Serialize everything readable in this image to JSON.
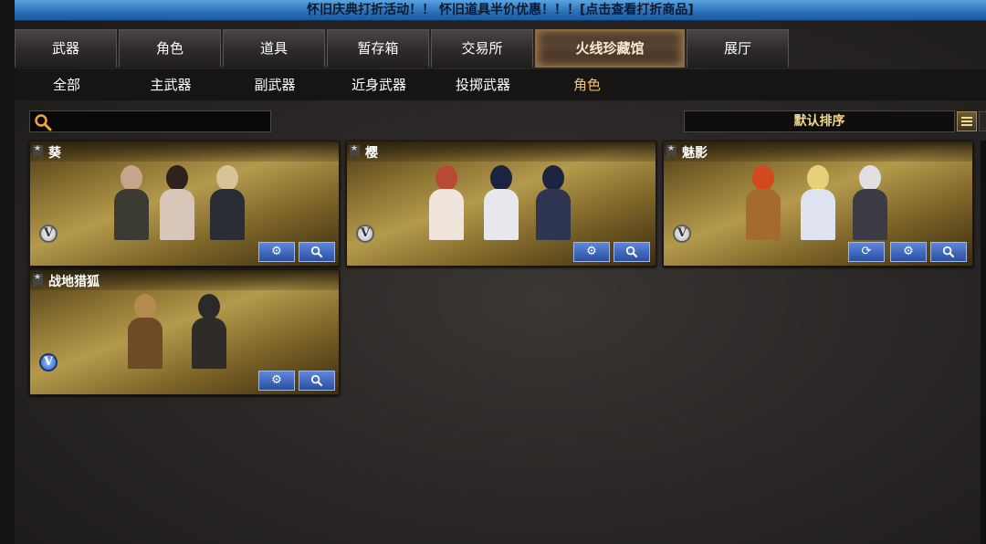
{
  "banner": {
    "text": "怀旧庆典打折活动！！ 怀旧道具半价优惠！！！[点击查看打折商品]"
  },
  "tabs": [
    {
      "label": "武器"
    },
    {
      "label": "角色"
    },
    {
      "label": "道具"
    },
    {
      "label": "暂存箱"
    },
    {
      "label": "交易所"
    },
    {
      "label": "火线珍藏馆",
      "active": true
    },
    {
      "label": "展厅"
    }
  ],
  "subtabs": [
    {
      "label": "全部"
    },
    {
      "label": "主武器"
    },
    {
      "label": "副武器"
    },
    {
      "label": "近身武器"
    },
    {
      "label": "投掷武器"
    },
    {
      "label": "角色",
      "active": true
    }
  ],
  "search": {
    "placeholder": "",
    "value": ""
  },
  "sort": {
    "label": "默认排序"
  },
  "cards": [
    {
      "name": "葵",
      "badge": "V",
      "badge_color": "silver",
      "buttons": [
        "gear-icon",
        "search-icon"
      ]
    },
    {
      "name": "樱",
      "badge": "V",
      "badge_color": "silver",
      "buttons": [
        "gear-icon",
        "search-icon"
      ]
    },
    {
      "name": "魅影",
      "badge": "V",
      "badge_color": "silver",
      "buttons": [
        "refresh-icon",
        "gear-icon",
        "search-icon"
      ]
    },
    {
      "name": "战地猎狐",
      "badge": "V",
      "badge_color": "blue",
      "buttons": [
        "gear-icon",
        "search-icon"
      ]
    }
  ],
  "colors": {
    "active_subtab": "#f5c46a",
    "banner": "#2a6fb8",
    "card_gold": "#b49a4c",
    "button_blue": "#3d64bb"
  }
}
